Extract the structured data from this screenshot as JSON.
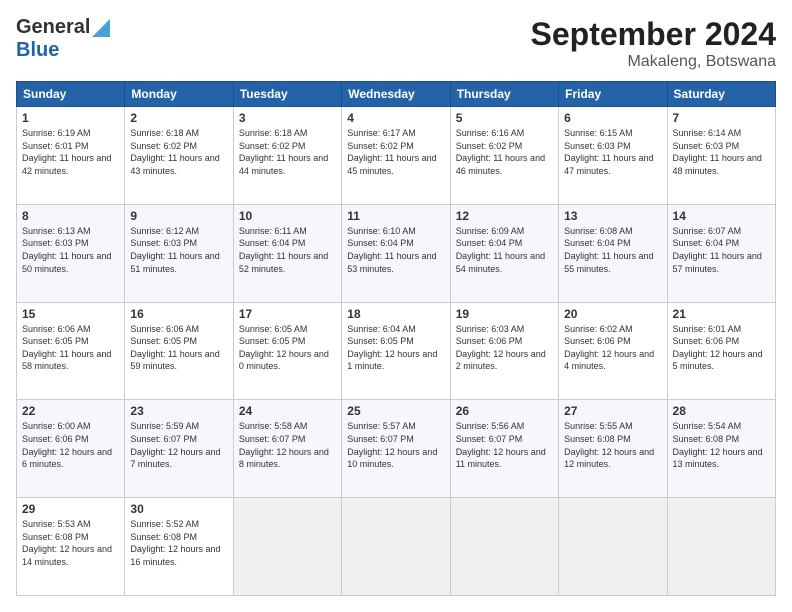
{
  "header": {
    "logo_line1": "General",
    "logo_line2": "Blue",
    "title": "September 2024",
    "location": "Makaleng, Botswana"
  },
  "calendar": {
    "weekdays": [
      "Sunday",
      "Monday",
      "Tuesday",
      "Wednesday",
      "Thursday",
      "Friday",
      "Saturday"
    ],
    "weeks": [
      [
        {
          "day": "1",
          "sunrise": "6:19 AM",
          "sunset": "6:01 PM",
          "daylight": "11 hours and 42 minutes."
        },
        {
          "day": "2",
          "sunrise": "6:18 AM",
          "sunset": "6:02 PM",
          "daylight": "11 hours and 43 minutes."
        },
        {
          "day": "3",
          "sunrise": "6:18 AM",
          "sunset": "6:02 PM",
          "daylight": "11 hours and 44 minutes."
        },
        {
          "day": "4",
          "sunrise": "6:17 AM",
          "sunset": "6:02 PM",
          "daylight": "11 hours and 45 minutes."
        },
        {
          "day": "5",
          "sunrise": "6:16 AM",
          "sunset": "6:02 PM",
          "daylight": "11 hours and 46 minutes."
        },
        {
          "day": "6",
          "sunrise": "6:15 AM",
          "sunset": "6:03 PM",
          "daylight": "11 hours and 47 minutes."
        },
        {
          "day": "7",
          "sunrise": "6:14 AM",
          "sunset": "6:03 PM",
          "daylight": "11 hours and 48 minutes."
        }
      ],
      [
        {
          "day": "8",
          "sunrise": "6:13 AM",
          "sunset": "6:03 PM",
          "daylight": "11 hours and 50 minutes."
        },
        {
          "day": "9",
          "sunrise": "6:12 AM",
          "sunset": "6:03 PM",
          "daylight": "11 hours and 51 minutes."
        },
        {
          "day": "10",
          "sunrise": "6:11 AM",
          "sunset": "6:04 PM",
          "daylight": "11 hours and 52 minutes."
        },
        {
          "day": "11",
          "sunrise": "6:10 AM",
          "sunset": "6:04 PM",
          "daylight": "11 hours and 53 minutes."
        },
        {
          "day": "12",
          "sunrise": "6:09 AM",
          "sunset": "6:04 PM",
          "daylight": "11 hours and 54 minutes."
        },
        {
          "day": "13",
          "sunrise": "6:08 AM",
          "sunset": "6:04 PM",
          "daylight": "11 hours and 55 minutes."
        },
        {
          "day": "14",
          "sunrise": "6:07 AM",
          "sunset": "6:04 PM",
          "daylight": "11 hours and 57 minutes."
        }
      ],
      [
        {
          "day": "15",
          "sunrise": "6:06 AM",
          "sunset": "6:05 PM",
          "daylight": "11 hours and 58 minutes."
        },
        {
          "day": "16",
          "sunrise": "6:06 AM",
          "sunset": "6:05 PM",
          "daylight": "11 hours and 59 minutes."
        },
        {
          "day": "17",
          "sunrise": "6:05 AM",
          "sunset": "6:05 PM",
          "daylight": "12 hours and 0 minutes."
        },
        {
          "day": "18",
          "sunrise": "6:04 AM",
          "sunset": "6:05 PM",
          "daylight": "12 hours and 1 minute."
        },
        {
          "day": "19",
          "sunrise": "6:03 AM",
          "sunset": "6:06 PM",
          "daylight": "12 hours and 2 minutes."
        },
        {
          "day": "20",
          "sunrise": "6:02 AM",
          "sunset": "6:06 PM",
          "daylight": "12 hours and 4 minutes."
        },
        {
          "day": "21",
          "sunrise": "6:01 AM",
          "sunset": "6:06 PM",
          "daylight": "12 hours and 5 minutes."
        }
      ],
      [
        {
          "day": "22",
          "sunrise": "6:00 AM",
          "sunset": "6:06 PM",
          "daylight": "12 hours and 6 minutes."
        },
        {
          "day": "23",
          "sunrise": "5:59 AM",
          "sunset": "6:07 PM",
          "daylight": "12 hours and 7 minutes."
        },
        {
          "day": "24",
          "sunrise": "5:58 AM",
          "sunset": "6:07 PM",
          "daylight": "12 hours and 8 minutes."
        },
        {
          "day": "25",
          "sunrise": "5:57 AM",
          "sunset": "6:07 PM",
          "daylight": "12 hours and 10 minutes."
        },
        {
          "day": "26",
          "sunrise": "5:56 AM",
          "sunset": "6:07 PM",
          "daylight": "12 hours and 11 minutes."
        },
        {
          "day": "27",
          "sunrise": "5:55 AM",
          "sunset": "6:08 PM",
          "daylight": "12 hours and 12 minutes."
        },
        {
          "day": "28",
          "sunrise": "5:54 AM",
          "sunset": "6:08 PM",
          "daylight": "12 hours and 13 minutes."
        }
      ],
      [
        {
          "day": "29",
          "sunrise": "5:53 AM",
          "sunset": "6:08 PM",
          "daylight": "12 hours and 14 minutes."
        },
        {
          "day": "30",
          "sunrise": "5:52 AM",
          "sunset": "6:08 PM",
          "daylight": "12 hours and 16 minutes."
        },
        null,
        null,
        null,
        null,
        null
      ]
    ]
  }
}
